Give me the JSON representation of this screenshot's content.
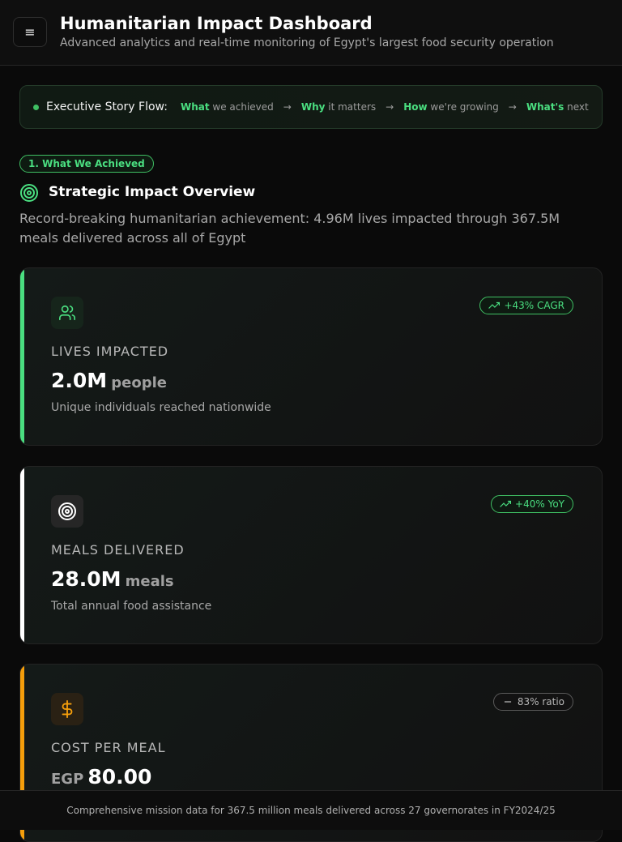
{
  "header": {
    "menu_icon": "≡",
    "title": "Humanitarian Impact Dashboard",
    "subtitle": "Advanced analytics and real-time monitoring of Egypt's largest food security operation"
  },
  "story_flow": {
    "label": "Executive Story Flow:",
    "steps": [
      {
        "strong": "What",
        "rest": " we achieved"
      },
      {
        "strong": "Why",
        "rest": " it matters"
      },
      {
        "strong": "How",
        "rest": " we're growing"
      },
      {
        "strong": "What's",
        "rest": " next"
      }
    ],
    "arrow": "→"
  },
  "section": {
    "pill": "1. What We Achieved",
    "icon": "target-icon",
    "title": "Strategic Impact Overview",
    "description": "Record-breaking humanitarian achievement: 4.96M lives impacted through 367.5M meals delivered across all of Egypt"
  },
  "cards": [
    {
      "icon": "users-icon",
      "accent": "#4ade80",
      "badge": "+43% CAGR",
      "badge_icon": "trending-up-icon",
      "label": "LIVES IMPACTED",
      "value": "2.0M",
      "unit": "people",
      "note": "Unique individuals reached nationwide"
    },
    {
      "icon": "target-icon",
      "accent": "#ffffff",
      "badge": "+40% YoY",
      "badge_icon": "trending-up-icon",
      "label": "MEALS DELIVERED",
      "value": "28.0M",
      "unit": "meals",
      "note": "Total annual food assistance"
    },
    {
      "icon": "dollar-icon",
      "accent": "#f59e0b",
      "badge": "83% ratio",
      "badge_icon": "minus-icon",
      "label": "COST PER MEAL",
      "prefix": "EGP",
      "value": "80.00"
    }
  ],
  "footer": {
    "text": "Comprehensive mission data for 367.5 million meals delivered across 27 governorates in FY2024/25"
  }
}
